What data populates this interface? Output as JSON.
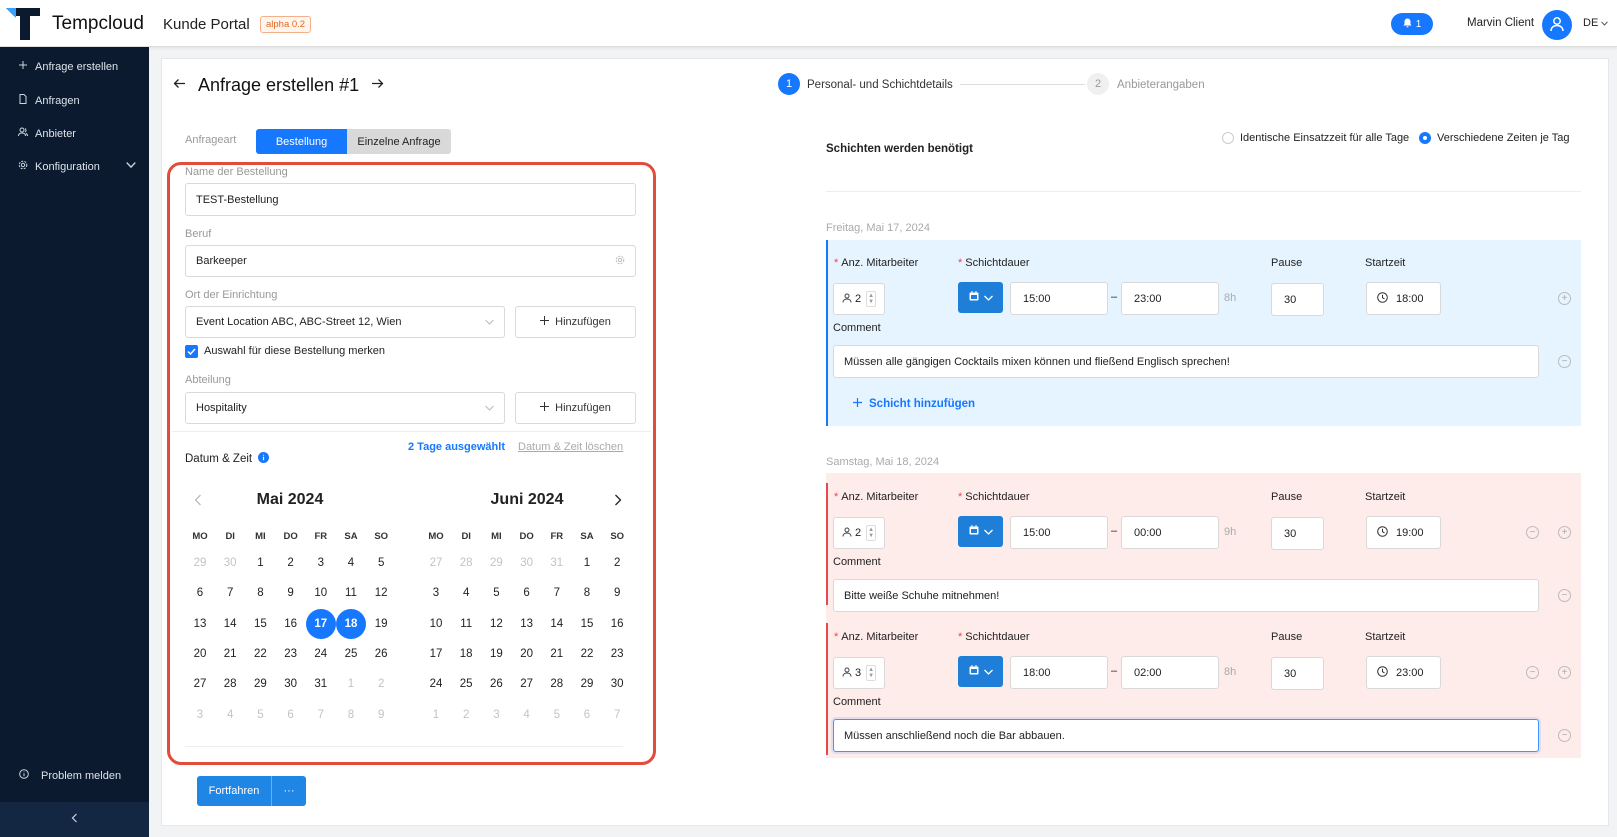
{
  "header": {
    "brand": "Tempcloud",
    "portal": "Kunde Portal",
    "badge": "alpha 0.2",
    "notifications": "1",
    "user": "Marvin Client",
    "lang": "DE"
  },
  "sidebar": {
    "items": [
      {
        "label": "Anfrage erstellen",
        "icon": "plus-icon"
      },
      {
        "label": "Anfragen",
        "icon": "file-icon"
      },
      {
        "label": "Anbieter",
        "icon": "users-icon"
      },
      {
        "label": "Konfiguration",
        "icon": "gear-icon"
      }
    ],
    "problem": "Problem melden"
  },
  "page": {
    "title": "Anfrage erstellen #1",
    "steps": [
      {
        "num": "1",
        "label": "Personal- und Schichtdetails",
        "active": true
      },
      {
        "num": "2",
        "label": "Anbieterangaben",
        "active": false
      }
    ]
  },
  "form": {
    "type_label": "Anfrageart",
    "type_options": [
      "Bestellung",
      "Einzelne Anfrage"
    ],
    "name_label": "Name der Bestellung",
    "name_value": "TEST-Bestellung",
    "job_label": "Beruf",
    "job_value": "Barkeeper",
    "location_label": "Ort der Einrichtung",
    "location_value": "Event Location ABC, ABC-Street 12, Wien",
    "add_label": "Hinzufügen",
    "remember_label": "Auswahl für diese Bestellung merken",
    "dept_label": "Abteilung",
    "dept_value": "Hospitality",
    "datetime_label": "Datum & Zeit",
    "days_selected": "2 Tage ausgewählt",
    "clear_label": "Datum & Zeit löschen"
  },
  "calendar": {
    "dow": [
      "MO",
      "DI",
      "MI",
      "DO",
      "FR",
      "SA",
      "SO"
    ],
    "months": [
      {
        "title": "Mai 2024",
        "days": [
          [
            "29",
            "30",
            "1",
            "2",
            "3",
            "4",
            "5"
          ],
          [
            "6",
            "7",
            "8",
            "9",
            "10",
            "11",
            "12"
          ],
          [
            "13",
            "14",
            "15",
            "16",
            "17",
            "18",
            "19"
          ],
          [
            "20",
            "21",
            "22",
            "23",
            "24",
            "25",
            "26"
          ],
          [
            "27",
            "28",
            "29",
            "30",
            "31",
            "1",
            "2"
          ],
          [
            "3",
            "4",
            "5",
            "6",
            "7",
            "8",
            "9"
          ]
        ]
      },
      {
        "title": "Juni 2024",
        "days": [
          [
            "27",
            "28",
            "29",
            "30",
            "31",
            "1",
            "2"
          ],
          [
            "3",
            "4",
            "5",
            "6",
            "7",
            "8",
            "9"
          ],
          [
            "10",
            "11",
            "12",
            "13",
            "14",
            "15",
            "16"
          ],
          [
            "17",
            "18",
            "19",
            "20",
            "21",
            "22",
            "23"
          ],
          [
            "24",
            "25",
            "26",
            "27",
            "28",
            "29",
            "30"
          ],
          [
            "1",
            "2",
            "3",
            "4",
            "5",
            "6",
            "7"
          ]
        ]
      }
    ]
  },
  "shifts": {
    "title": "Schichten werden benötigt",
    "mode_same": "Identische Einsatzzeit für alle Tage",
    "mode_diff": "Verschiedene Zeiten je Tag",
    "labels": {
      "employees": "Anz. Mitarbeiter",
      "duration": "Schichtdauer",
      "pause": "Pause",
      "start": "Startzeit",
      "comment": "Comment"
    },
    "add_shift": "Schicht hinzufügen",
    "days": [
      {
        "date": "Freitag, Mai 17, 2024",
        "entries": [
          {
            "count": "2",
            "from": "15:00",
            "to": "23:00",
            "hours": "8h",
            "pause": "30",
            "start": "18:00",
            "comment": "Müssen alle gängigen Cocktails mixen können und fließend Englisch sprechen!"
          }
        ]
      },
      {
        "date": "Samstag, Mai 18, 2024",
        "entries": [
          {
            "count": "2",
            "from": "15:00",
            "to": "00:00",
            "hours": "9h",
            "pause": "30",
            "start": "19:00",
            "comment": "Bitte weiße Schuhe mitnehmen!"
          },
          {
            "count": "3",
            "from": "18:00",
            "to": "02:00",
            "hours": "8h",
            "pause": "30",
            "start": "23:00",
            "comment": "Müssen anschließend noch die Bar abbauen."
          }
        ]
      }
    ]
  },
  "footer": {
    "continue": "Fortfahren",
    "more": "···"
  },
  "colors": {
    "primary": "#1677ff",
    "sidebar": "#0b1a2f",
    "highlight": "#e34b3b",
    "blue_bg": "#e6f4ff",
    "red_bg": "#fdecea"
  }
}
